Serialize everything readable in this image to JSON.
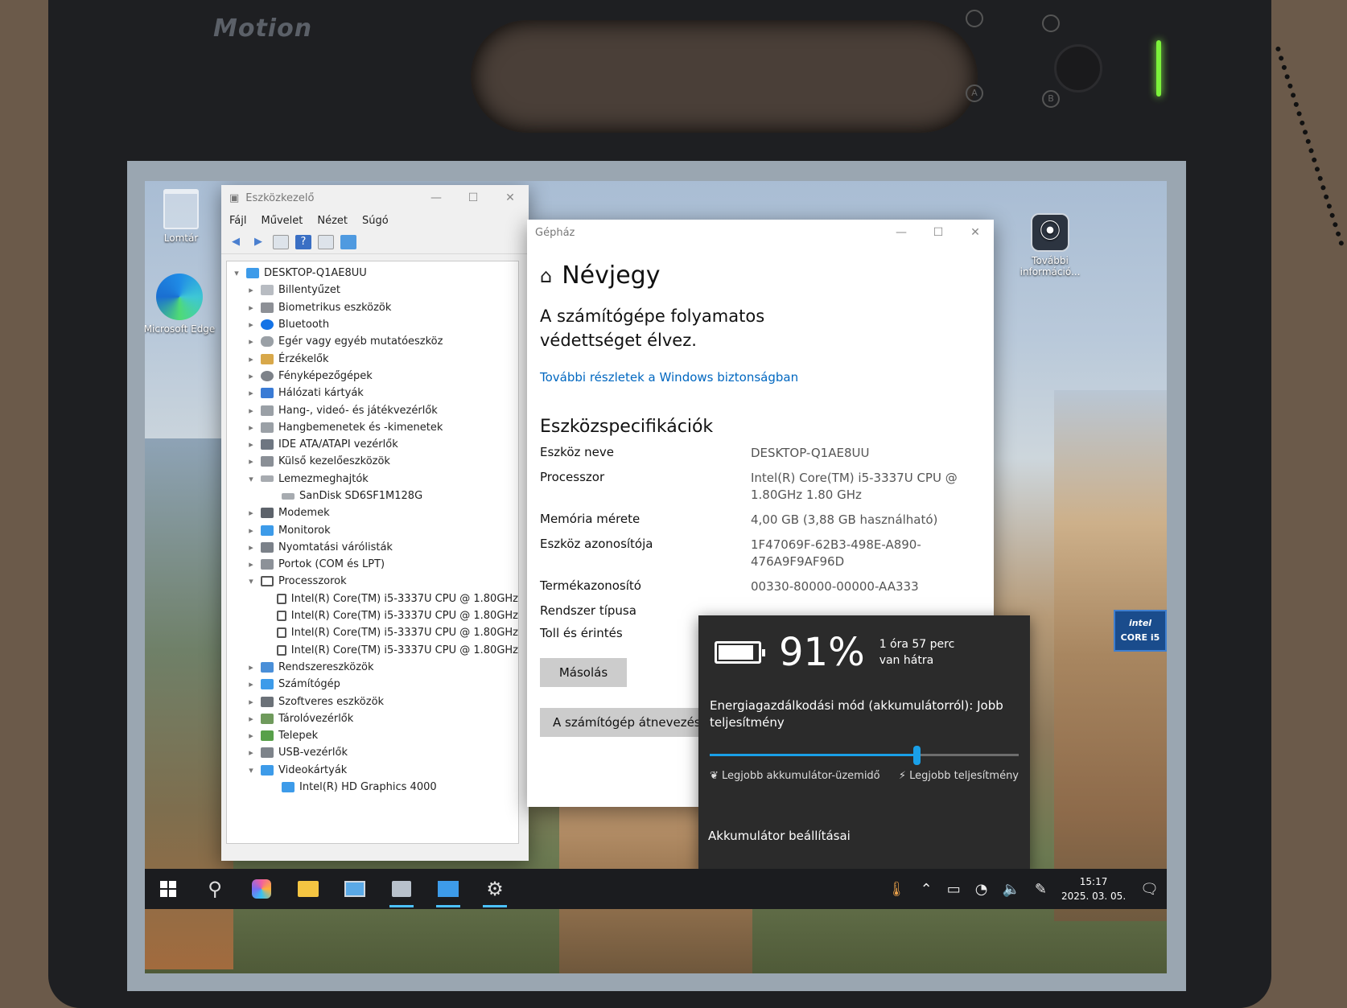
{
  "device": {
    "brand": "Motion",
    "buttons": [
      "A",
      "B"
    ]
  },
  "desktop": {
    "icons": [
      {
        "label": "Lomtár"
      },
      {
        "label": "Microsoft Edge"
      },
      {
        "label": "További információ..."
      }
    ]
  },
  "devmgr": {
    "title": "Eszközkezelő",
    "menu": [
      "Fájl",
      "Művelet",
      "Nézet",
      "Súgó"
    ],
    "root": "DESKTOP-Q1AE8UU",
    "nodes": [
      {
        "label": "Billentyűzet",
        "expanded": false
      },
      {
        "label": "Biometrikus eszközök",
        "expanded": false
      },
      {
        "label": "Bluetooth",
        "expanded": false
      },
      {
        "label": "Egér vagy egyéb mutatóeszköz",
        "expanded": false
      },
      {
        "label": "Érzékelők",
        "expanded": false
      },
      {
        "label": "Fényképezőgépek",
        "expanded": false
      },
      {
        "label": "Hálózati kártyák",
        "expanded": false
      },
      {
        "label": "Hang-, videó- és játékvezérlők",
        "expanded": false
      },
      {
        "label": "Hangbemenetek és -kimenetek",
        "expanded": false
      },
      {
        "label": "IDE ATA/ATAPI vezérlők",
        "expanded": false
      },
      {
        "label": "Külső kezelőeszközök",
        "expanded": false
      },
      {
        "label": "Lemezmeghajtók",
        "expanded": true,
        "children": [
          "SanDisk SD6SF1M128G"
        ]
      },
      {
        "label": "Modemek",
        "expanded": false
      },
      {
        "label": "Monitorok",
        "expanded": false
      },
      {
        "label": "Nyomtatási várólisták",
        "expanded": false
      },
      {
        "label": "Portok (COM és LPT)",
        "expanded": false
      },
      {
        "label": "Processzorok",
        "expanded": true,
        "children": [
          "Intel(R) Core(TM) i5-3337U CPU @ 1.80GHz",
          "Intel(R) Core(TM) i5-3337U CPU @ 1.80GHz",
          "Intel(R) Core(TM) i5-3337U CPU @ 1.80GHz",
          "Intel(R) Core(TM) i5-3337U CPU @ 1.80GHz"
        ]
      },
      {
        "label": "Rendszereszközök",
        "expanded": false
      },
      {
        "label": "Számítógép",
        "expanded": false
      },
      {
        "label": "Szoftveres eszközök",
        "expanded": false
      },
      {
        "label": "Tárolóvezérlők",
        "expanded": false
      },
      {
        "label": "Telepek",
        "expanded": false
      },
      {
        "label": "USB-vezérlők",
        "expanded": false
      },
      {
        "label": "Videokártyák",
        "expanded": true,
        "children": [
          "Intel(R) HD Graphics 4000"
        ]
      }
    ]
  },
  "settings": {
    "app_title": "Gépház",
    "page_title": "Névjegy",
    "protection": "A számítógépe folyamatos védettséget élvez.",
    "security_link": "További részletek a Windows biztonságban",
    "spec_heading": "Eszközspecifikációk",
    "specs": [
      {
        "key": "Eszköz neve",
        "value": "DESKTOP-Q1AE8UU"
      },
      {
        "key": "Processzor",
        "value": "Intel(R) Core(TM) i5-3337U CPU @ 1.80GHz   1.80 GHz"
      },
      {
        "key": "Memória mérete",
        "value": "4,00 GB (3,88 GB használható)"
      },
      {
        "key": "Eszköz azonosítója",
        "value": "1F47069F-62B3-498E-A890-476A9F9AF96D"
      },
      {
        "key": "Termékazonosító",
        "value": "00330-80000-00000-AA333"
      },
      {
        "key": "Rendszer típusa",
        "value": ""
      },
      {
        "key": "Toll és érintés",
        "value": ""
      }
    ],
    "copy_button": "Másolás",
    "rename_button": "A számítógép átnevezése"
  },
  "battery": {
    "percent_label": "91%",
    "percent": 91,
    "remaining": "1 óra 57 perc van hátra",
    "mode_label": "Energiagazdálkodási mód (akkumulátorról): Jobb teljesítmény",
    "slider_position": 0.67,
    "left_label": "Legjobb akkumulátor-üzemidő",
    "right_label": "Legjobb teljesítmény",
    "settings_link": "Akkumulátor beállításai"
  },
  "taskbar": {
    "time": "15:17",
    "date": "2025. 03. 05."
  },
  "badge": {
    "brand": "intel",
    "model": "CORE i5"
  },
  "colors": {
    "accent": "#1aa0e8",
    "link": "#0067c0",
    "flyout_bg": "#2b2b2b",
    "taskbar_bg": "#1b1c1f"
  }
}
